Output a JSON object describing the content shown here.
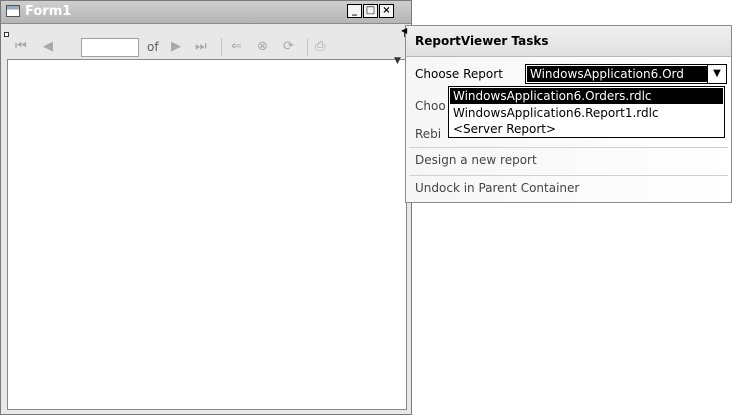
{
  "window": {
    "title": "Form1",
    "minimize_glyph": "_",
    "maximize_glyph": "□",
    "close_glyph": "×"
  },
  "toolbar": {
    "first_page_icon": "first-page-icon",
    "prev_page_icon": "previous-page-icon",
    "page_number": "",
    "of_label": "of",
    "next_page_icon": "next-page-icon",
    "last_page_icon": "last-page-icon",
    "back_icon": "back-icon",
    "stop_icon": "stop-icon",
    "refresh_icon": "refresh-icon",
    "print_icon": "print-icon"
  },
  "tasks_panel": {
    "title": "ReportViewer Tasks",
    "choose_report_label": "Choose Report",
    "selected_report": "WindowsApplication6.Ord",
    "choose_data_sources_partial": "Choo",
    "rebind_partial": "Rebi",
    "design_new_report": "Design a new report",
    "undock": "Undock in Parent Container"
  },
  "report_dropdown": {
    "options": [
      "WindowsApplication6.Orders.rdlc",
      "WindowsApplication6.Report1.rdlc",
      "<Server Report>"
    ],
    "selected_index": 0
  }
}
